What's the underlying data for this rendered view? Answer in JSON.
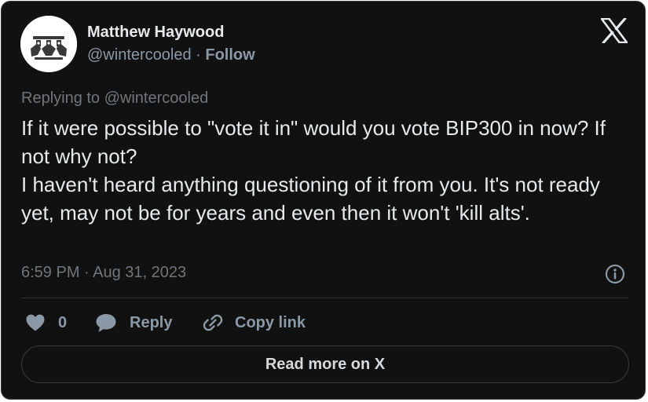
{
  "author": {
    "name": "Matthew Haywood",
    "handle": "@wintercooled",
    "separator": " · ",
    "follow_label": "Follow"
  },
  "reply_context": "Replying to @wintercooled",
  "tweet_text": "If it were possible to \"vote it in\" would you vote BIP300 in now? If not why not?\nI haven't heard anything questioning of it from you. It's not ready yet, may not be for years and even then it won't 'kill alts'.",
  "timestamp": "6:59 PM · Aug 31, 2023",
  "actions": {
    "like_count": "0",
    "reply_label": "Reply",
    "copy_link_label": "Copy link"
  },
  "read_more_label": "Read more on X",
  "icons": {
    "brand": "x-logo-icon",
    "like": "heart-icon",
    "reply": "speech-bubble-icon",
    "copy": "link-icon",
    "info": "info-icon"
  },
  "colors": {
    "background": "#111111",
    "text_primary": "#e7e9ea",
    "text_secondary": "#8b98a5",
    "border": "#3b3b3b"
  }
}
